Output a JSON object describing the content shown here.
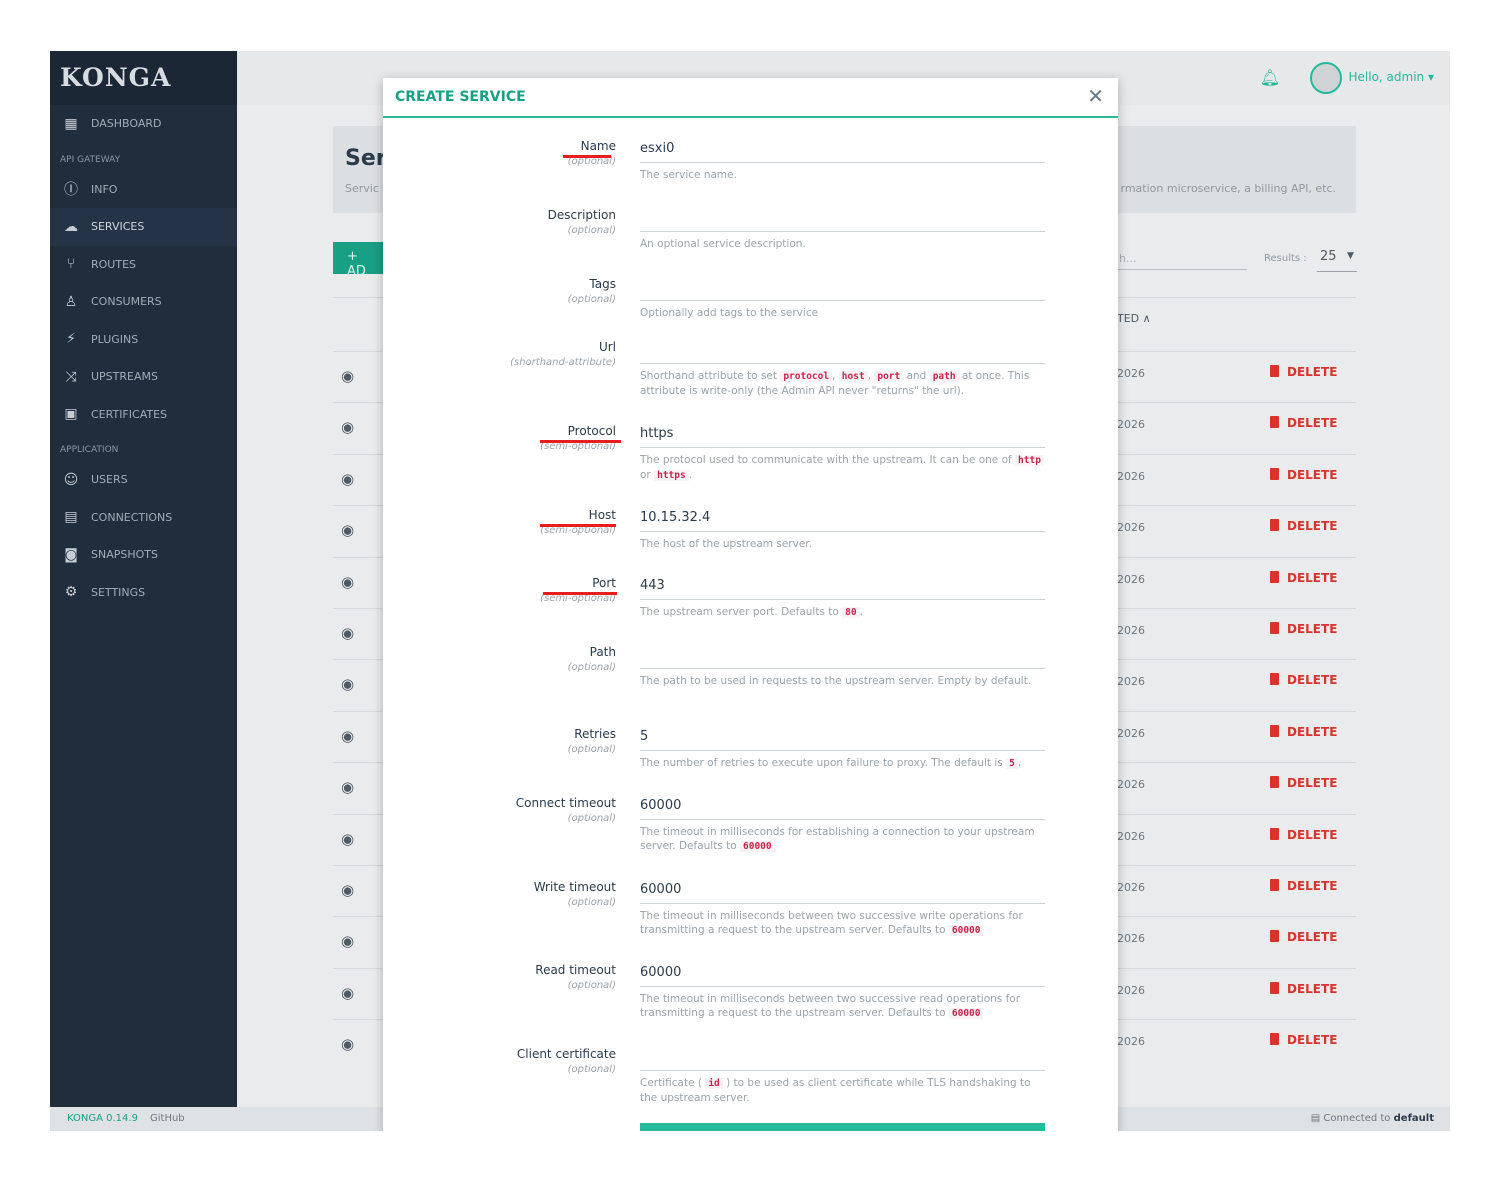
{
  "brand": "KONGA",
  "topbar": {
    "greeting": "Hello, admin ▾"
  },
  "sidebar": {
    "items_top": [
      {
        "label": "DASHBOARD",
        "icon": "▦"
      }
    ],
    "section_api": "API GATEWAY",
    "items_api": [
      {
        "label": "INFO",
        "icon": "ⓘ"
      },
      {
        "label": "SERVICES",
        "icon": "☁"
      },
      {
        "label": "ROUTES",
        "icon": "⑂"
      },
      {
        "label": "CONSUMERS",
        "icon": "♙"
      },
      {
        "label": "PLUGINS",
        "icon": "⚡"
      },
      {
        "label": "UPSTREAMS",
        "icon": "⤨"
      },
      {
        "label": "CERTIFICATES",
        "icon": "▣"
      }
    ],
    "section_app": "APPLICATION",
    "items_app": [
      {
        "label": "USERS",
        "icon": "☺"
      },
      {
        "label": "CONNECTIONS",
        "icon": "▤"
      },
      {
        "label": "SNAPSHOTS",
        "icon": "◙"
      },
      {
        "label": "SETTINGS",
        "icon": "⚙"
      }
    ]
  },
  "page": {
    "title": "Ser",
    "subtitle": "Servic",
    "subtitle_right": "rmation microservice, a billing API, etc.",
    "add_label": "+ AD",
    "search_placeholder": "h...",
    "results_label": "Results :",
    "results_value": "25",
    "col_head": "TED ∧",
    "row_year": "2026",
    "delete_label": "DELETE",
    "row_count": 14
  },
  "footer": {
    "version": "KONGA 0.14.9",
    "github": "GitHub",
    "connected_prefix": "Connected to",
    "connected_name": "default"
  },
  "modal": {
    "title": "CREATE SERVICE",
    "fields": [
      {
        "label": "Name",
        "hint": "(optional)",
        "value": "esxi0",
        "help": "The service name."
      },
      {
        "label": "Description",
        "hint": "(optional)",
        "value": "",
        "help": "An optional service description."
      },
      {
        "label": "Tags",
        "hint": "(optional)",
        "value": "",
        "help": "Optionally add tags to the service"
      },
      {
        "label": "Url",
        "hint": "(shorthand-attribute)",
        "value": "",
        "help_html": "Shorthand attribute to set <code>protocol</code>, <code>host</code>, <code>port</code> and <code>path</code> at once. This attribute is write-only (the Admin API never \"returns\" the url)."
      },
      {
        "label": "Protocol",
        "hint": "(semi-optional)",
        "value": "https",
        "help_html": "The protocol used to communicate with the upstream. It can be one of <code>http</code> or <code>https</code>."
      },
      {
        "label": "Host",
        "hint": "(semi-optional)",
        "value": "10.15.32.4",
        "help": "The host of the upstream server."
      },
      {
        "label": "Port",
        "hint": "(semi-optional)",
        "value": "443",
        "help_html": "The upstream server port. Defaults to <code>80</code>."
      },
      {
        "label": "Path",
        "hint": "(optional)",
        "value": "",
        "help": "The path to be used in requests to the upstream server. Empty by default."
      },
      {
        "label": "Retries",
        "hint": "(optional)",
        "value": "5",
        "help_html": "The number of retries to execute upon failure to proxy. The default is <code>5</code>."
      },
      {
        "label": "Connect timeout",
        "hint": "(optional)",
        "value": "60000",
        "help_html": "The timeout in milliseconds for establishing a connection to your upstream server. Defaults to <code>60000</code>"
      },
      {
        "label": "Write timeout",
        "hint": "(optional)",
        "value": "60000",
        "help_html": "The timeout in milliseconds between two successive write operations for transmitting a request to the upstream server. Defaults to <code>60000</code>"
      },
      {
        "label": "Read timeout",
        "hint": "(optional)",
        "value": "60000",
        "help_html": "The timeout in milliseconds between two successive read operations for transmitting a request to the upstream server. Defaults to <code>60000</code>"
      },
      {
        "label": "Client certificate",
        "hint": "(optional)",
        "value": "",
        "help_html": "Certificate ( <code>id</code> ) to be used as client certificate while TLS handshaking to the upstream server."
      }
    ]
  },
  "colors": {
    "accent": "#26b99a",
    "sidebar": "#1f2d3d",
    "danger": "#d9342b",
    "annotation": "#e81d1d"
  }
}
